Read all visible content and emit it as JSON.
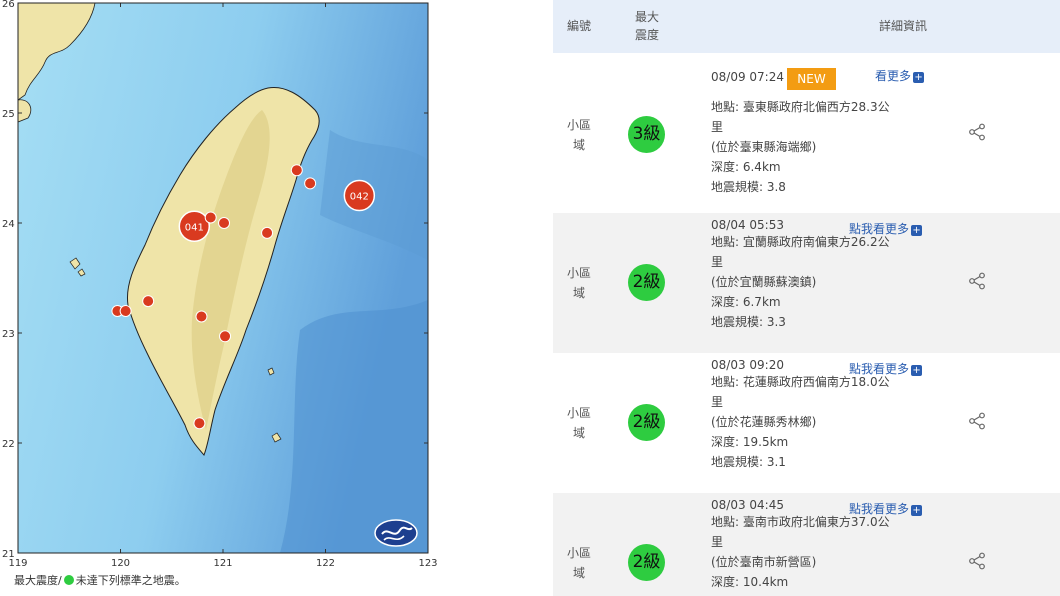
{
  "map": {
    "lat_labels": [
      "26",
      "25",
      "24",
      "23",
      "22",
      "21"
    ],
    "lon_labels": [
      "119",
      "120",
      "121",
      "122",
      "123"
    ],
    "markers": [
      {
        "lon": 120.72,
        "lat": 23.97,
        "label": "041",
        "big": true
      },
      {
        "lon": 122.33,
        "lat": 24.25,
        "label": "042",
        "big": true
      },
      {
        "lon": 121.72,
        "lat": 24.48,
        "label": "",
        "big": false
      },
      {
        "lon": 121.85,
        "lat": 24.36,
        "label": "",
        "big": false
      },
      {
        "lon": 120.88,
        "lat": 24.05,
        "label": "",
        "big": false
      },
      {
        "lon": 121.01,
        "lat": 24.0,
        "label": "",
        "big": false
      },
      {
        "lon": 121.43,
        "lat": 23.91,
        "label": "",
        "big": false
      },
      {
        "lon": 120.27,
        "lat": 23.29,
        "label": "",
        "big": false
      },
      {
        "lon": 119.97,
        "lat": 23.2,
        "label": "",
        "big": false
      },
      {
        "lon": 120.05,
        "lat": 23.2,
        "label": "",
        "big": false
      },
      {
        "lon": 120.79,
        "lat": 23.15,
        "label": "",
        "big": false
      },
      {
        "lon": 121.02,
        "lat": 22.97,
        "label": "",
        "big": false
      },
      {
        "lon": 120.77,
        "lat": 22.18,
        "label": "",
        "big": false
      }
    ],
    "legend_prefix": "最大震度/",
    "legend_text": "未達下列標準之地震。"
  },
  "table": {
    "headers": {
      "id": "編號",
      "max_line1": "最大",
      "max_line2": "震度",
      "detail": "詳細資訊"
    },
    "rows": [
      {
        "id_line1": "小區",
        "id_line2": "域",
        "intensity": "3級",
        "time": "08/09 07:24",
        "new": "NEW",
        "more": "看更多",
        "loc1": "地點: 臺東縣政府北偏西方28.3公",
        "loc2": "里",
        "loc3": "(位於臺東縣海端鄉)",
        "depth": "深度: 6.4km",
        "mag": "地震規模: 3.8"
      },
      {
        "id_line1": "小區",
        "id_line2": "域",
        "intensity": "2級",
        "time": "08/04 05:53",
        "new": "",
        "more": "點我看更多",
        "loc1": "地點: 宜蘭縣政府南偏東方26.2公",
        "loc2": "里",
        "loc3": "(位於宜蘭縣蘇澳鎮)",
        "depth": "深度: 6.7km",
        "mag": "地震規模: 3.3"
      },
      {
        "id_line1": "小區",
        "id_line2": "域",
        "intensity": "2級",
        "time": "08/03 09:20",
        "new": "",
        "more": "點我看更多",
        "loc1": "地點: 花蓮縣政府西偏南方18.0公",
        "loc2": "里",
        "loc3": "(位於花蓮縣秀林鄉)",
        "depth": "深度: 19.5km",
        "mag": "地震規模: 3.1"
      },
      {
        "id_line1": "小區",
        "id_line2": "域",
        "intensity": "2級",
        "time": "08/03 04:45",
        "new": "",
        "more": "點我看更多",
        "loc1": "地點: 臺南市政府北偏東方37.0公",
        "loc2": "里",
        "loc3": "(位於臺南市新營區)",
        "depth": "深度: 10.4km",
        "mag": ""
      }
    ]
  },
  "colors": {
    "ocean": "#8fd3ef",
    "deep_ocean": "#5b9fd6",
    "land": "#efe4a8",
    "marker": "#d93a1f",
    "green": "#2ecc40",
    "header_bg": "#e6eef9",
    "link": "#2a5db0",
    "new_tag": "#f39c12"
  },
  "icons": [
    "share-icon",
    "plus-icon",
    "cwb-logo-icon"
  ]
}
